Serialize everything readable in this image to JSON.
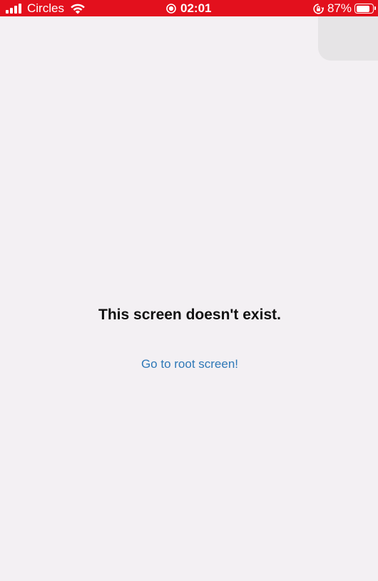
{
  "status_bar": {
    "carrier": "Circles",
    "time": "02:01",
    "battery_percent": "87%",
    "battery_level": 0.87,
    "background_color": "#e3101d",
    "icons": [
      "signal-icon",
      "wifi-icon",
      "record-icon",
      "rotation-lock-icon",
      "battery-icon"
    ]
  },
  "main": {
    "title": "This screen doesn't exist.",
    "link_label": "Go to root screen!",
    "link_color": "#2e78b7",
    "background_color": "#f3f0f3"
  }
}
